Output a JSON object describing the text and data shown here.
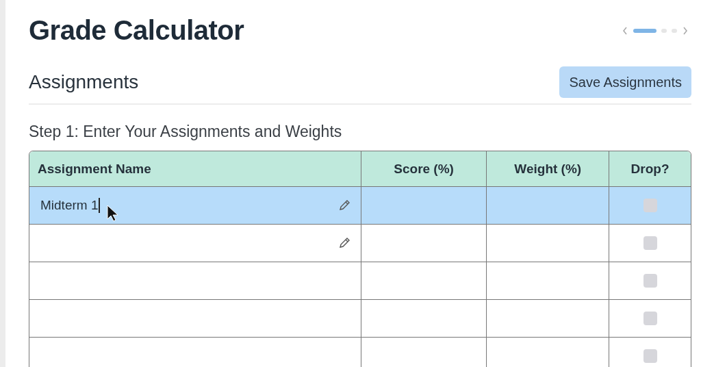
{
  "title": "Grade Calculator",
  "pager": {
    "dots": [
      {
        "selected": true
      },
      {
        "selected": false
      },
      {
        "selected": false
      }
    ]
  },
  "section": {
    "title": "Assignments",
    "button": "Save Assignments"
  },
  "step": "Step 1: Enter Your Assignments and Weights",
  "table": {
    "columns": [
      "Assignment Name",
      "Score (%)",
      "Weight (%)",
      "Drop?"
    ],
    "rows": [
      {
        "kind": "editable",
        "name": "Midterm 1",
        "selected": true,
        "drop": false
      },
      {
        "kind": "editable",
        "selected": false,
        "drop": false
      },
      {
        "kind": "plain",
        "selected": false,
        "drop": false
      },
      {
        "kind": "plain",
        "selected": false,
        "drop": false
      },
      {
        "kind": "plain",
        "selected": false,
        "drop": false
      }
    ]
  }
}
